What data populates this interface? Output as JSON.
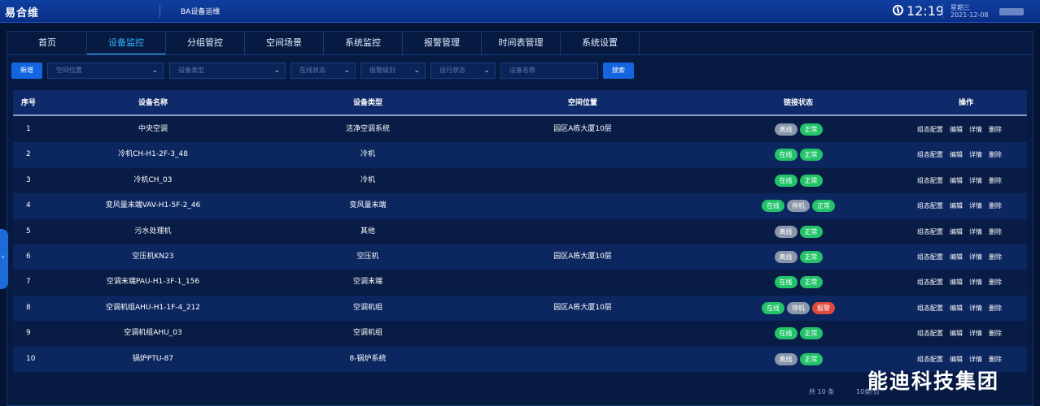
{
  "header": {
    "logo": "易合维",
    "app_title": "BA设备运维",
    "time": "12:19",
    "weekday": "星期三",
    "date": "2021-12-08"
  },
  "nav": {
    "tabs": [
      "首页",
      "设备监控",
      "分组管控",
      "空间场景",
      "系统监控",
      "报警管理",
      "时间表管理",
      "系统设置"
    ],
    "active": "设备监控"
  },
  "filters": {
    "add_button": "新增",
    "location_placeholder": "空间位置",
    "type_placeholder": "设备类型",
    "online_placeholder": "在线状态",
    "alarm_placeholder": "报警级别",
    "run_placeholder": "运行状态",
    "name_placeholder": "设备名称",
    "search_button": "搜索"
  },
  "table": {
    "columns": [
      "序号",
      "设备名称",
      "设备类型",
      "空间位置",
      "链接状态",
      "操作"
    ],
    "actions": [
      "组态配置",
      "编辑",
      "详情",
      "删除"
    ],
    "status_colors": {
      "离线": "#8a97aa",
      "在线": "#23c36a",
      "正常": "#23c36a",
      "停机": "#8a97aa",
      "报警": "#e04a3b"
    },
    "rows": [
      {
        "no": "1",
        "name": "中央空调",
        "type": "洁净空调系统",
        "location": "园区A栋大厦10层",
        "status": [
          "离线",
          "正常"
        ]
      },
      {
        "no": "2",
        "name": "冷机CH-H1-2F-3_48",
        "type": "冷机",
        "location": "",
        "status": [
          "在线",
          "正常"
        ]
      },
      {
        "no": "3",
        "name": "冷机CH_03",
        "type": "冷机",
        "location": "",
        "status": [
          "在线",
          "正常"
        ]
      },
      {
        "no": "4",
        "name": "变风量末端VAV-H1-5F-2_46",
        "type": "变风量末端",
        "location": "",
        "status": [
          "在线",
          "停机",
          "正常"
        ]
      },
      {
        "no": "5",
        "name": "污水处理机",
        "type": "其他",
        "location": "",
        "status": [
          "离线",
          "正常"
        ]
      },
      {
        "no": "6",
        "name": "空压机KN23",
        "type": "空压机",
        "location": "园区A栋大厦10层",
        "status": [
          "离线",
          "正常"
        ]
      },
      {
        "no": "7",
        "name": "空调末端PAU-H1-3F-1_156",
        "type": "空调末端",
        "location": "",
        "status": [
          "在线",
          "正常"
        ]
      },
      {
        "no": "8",
        "name": "空调机组AHU-H1-1F-4_212",
        "type": "空调机组",
        "location": "园区A栋大厦10层",
        "status": [
          "在线",
          "停机",
          "报警"
        ]
      },
      {
        "no": "9",
        "name": "空调机组AHU_03",
        "type": "空调机组",
        "location": "",
        "status": [
          "在线",
          "正常"
        ]
      },
      {
        "no": "10",
        "name": "锅炉PTU-87",
        "type": "8-锅炉系统",
        "location": "",
        "status": [
          "离线",
          "正常"
        ]
      }
    ]
  },
  "pager": {
    "total": "共 10 条",
    "page_size": "10条/页"
  },
  "watermark": "能迪科技集团"
}
